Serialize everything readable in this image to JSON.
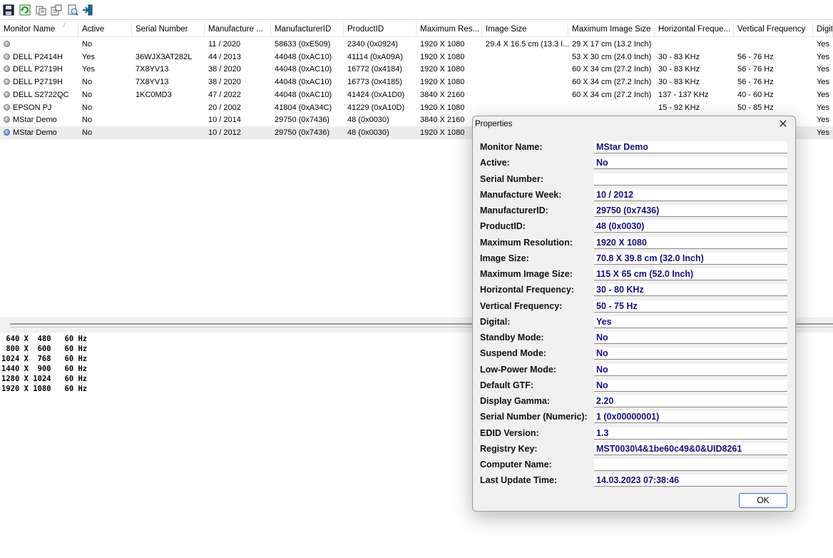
{
  "toolbar": {
    "buttons": [
      {
        "name": "save-icon",
        "icon": "floppy"
      },
      {
        "name": "refresh-icon",
        "icon": "refresh"
      },
      {
        "name": "copy-icon",
        "icon": "copy"
      },
      {
        "name": "properties-icon",
        "icon": "properties"
      },
      {
        "name": "html-report-icon",
        "icon": "report"
      },
      {
        "name": "exit-icon",
        "icon": "exit"
      }
    ]
  },
  "table": {
    "columns": [
      "Monitor Name",
      "Active",
      "Serial Number",
      "Manufacture ...",
      "ManufacturerID",
      "ProductID",
      "Maximum Res...",
      "Image Size",
      "Maximum Image Size",
      "Horizontal Freque...",
      "Vertical Frequency",
      "Digit"
    ],
    "rows": [
      {
        "icon": "gray",
        "cells": [
          "",
          "No",
          "",
          "11 / 2020",
          "58633 (0xE509)",
          "2340 (0x0924)",
          "1920 X 1080",
          "29.4 X 16.5 cm (13.3 I...",
          "29 X 17 cm (13.2 Inch)",
          "",
          "",
          "Yes"
        ]
      },
      {
        "icon": "gray",
        "cells": [
          "DELL P2414H",
          "Yes",
          "36WJX3AT282L",
          "44 / 2013",
          "44048 (0xAC10)",
          "41114 (0xA09A)",
          "1920 X 1080",
          "",
          "53 X 30 cm (24.0 Inch)",
          "30 - 83 KHz",
          "56 - 76 Hz",
          "Yes"
        ]
      },
      {
        "icon": "gray",
        "cells": [
          "DELL P2719H",
          "Yes",
          "7X8YV13",
          "38 / 2020",
          "44048 (0xAC10)",
          "16772 (0x4184)",
          "1920 X 1080",
          "",
          "60 X 34 cm (27.2 Inch)",
          "30 - 83 KHz",
          "56 - 76 Hz",
          "Yes"
        ]
      },
      {
        "icon": "gray",
        "cells": [
          "DELL P2719H",
          "No",
          "7X8YV13",
          "38 / 2020",
          "44048 (0xAC10)",
          "16773 (0x4185)",
          "1920 X 1080",
          "",
          "60 X 34 cm (27.2 Inch)",
          "30 - 83 KHz",
          "56 - 76 Hz",
          "Yes"
        ]
      },
      {
        "icon": "gray",
        "cells": [
          "DELL S2722QC",
          "No",
          "1KC0MD3",
          "47 / 2022",
          "44048 (0xAC10)",
          "41424 (0xA1D0)",
          "3840 X 2160",
          "",
          "60 X 34 cm (27.2 Inch)",
          "137 - 137 KHz",
          "40 - 60 Hz",
          "Yes"
        ]
      },
      {
        "icon": "gray",
        "cells": [
          "EPSON PJ",
          "No",
          "",
          "20 / 2002",
          "41804 (0xA34C)",
          "41229 (0xA10D)",
          "1920 X 1080",
          "",
          "",
          "15 - 92 KHz",
          "50 - 85 Hz",
          "Yes"
        ]
      },
      {
        "icon": "gray",
        "cells": [
          "MStar Demo",
          "No",
          "",
          "10 / 2014",
          "29750 (0x7436)",
          "48 (0x0030)",
          "3840 X 2160",
          "",
          "",
          "",
          "",
          "Yes"
        ]
      },
      {
        "icon": "globe",
        "cells": [
          "MStar Demo",
          "No",
          "",
          "10 / 2012",
          "29750 (0x7436)",
          "48 (0x0030)",
          "1920 X 1080",
          "",
          "",
          "",
          "",
          "Yes"
        ]
      }
    ]
  },
  "modes": [
    " 640 X  480   60 Hz",
    " 800 X  600   60 Hz",
    "1024 X  768   60 Hz",
    "1440 X  900   60 Hz",
    "1280 X 1024   60 Hz",
    "1920 X 1080   60 Hz"
  ],
  "dialog": {
    "title": "Properties",
    "close_label": "✕",
    "ok_label": "OK",
    "properties": [
      {
        "label": "Monitor Name:",
        "value": "MStar Demo"
      },
      {
        "label": "Active:",
        "value": "No"
      },
      {
        "label": "Serial Number:",
        "value": ""
      },
      {
        "label": "Manufacture Week:",
        "value": "10 / 2012"
      },
      {
        "label": "ManufacturerID:",
        "value": "29750 (0x7436)"
      },
      {
        "label": "ProductID:",
        "value": "48 (0x0030)"
      },
      {
        "label": "Maximum Resolution:",
        "value": "1920 X 1080"
      },
      {
        "label": "Image Size:",
        "value": "70.8 X 39.8 cm (32.0 Inch)"
      },
      {
        "label": "Maximum Image Size:",
        "value": "115 X 65 cm (52.0 Inch)"
      },
      {
        "label": "Horizontal Frequency:",
        "value": "30 - 80 KHz"
      },
      {
        "label": "Vertical Frequency:",
        "value": "50 - 75 Hz"
      },
      {
        "label": "Digital:",
        "value": "Yes"
      },
      {
        "label": "Standby Mode:",
        "value": "No"
      },
      {
        "label": "Suspend Mode:",
        "value": "No"
      },
      {
        "label": "Low-Power Mode:",
        "value": "No"
      },
      {
        "label": "Default GTF:",
        "value": "No"
      },
      {
        "label": "Display Gamma:",
        "value": "2.20"
      },
      {
        "label": "Serial Number (Numeric):",
        "value": "1 (0x00000001)"
      },
      {
        "label": "EDID Version:",
        "value": "1.3"
      },
      {
        "label": "Registry Key:",
        "value": "MST0030\\4&1be60c49&0&UID8261"
      },
      {
        "label": "Computer Name:",
        "value": ""
      },
      {
        "label": "Last Update Time:",
        "value": "14.03.2023 07:38:46"
      }
    ]
  },
  "colors": {
    "field_text": "#12127a",
    "selection": "#ececec",
    "ok_border": "#2d6fd1"
  }
}
